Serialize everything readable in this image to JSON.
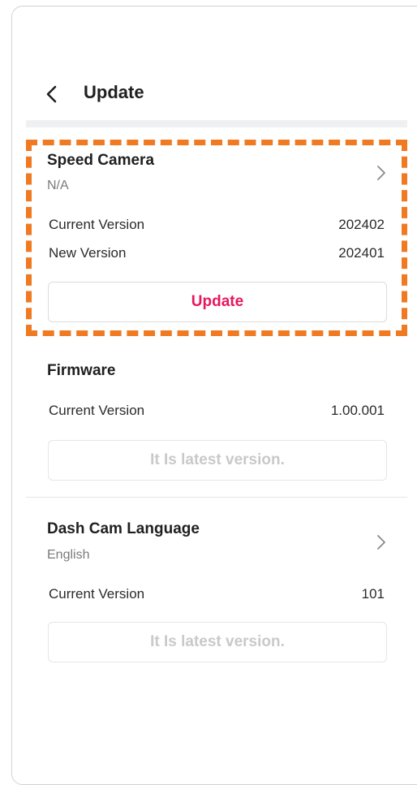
{
  "header": {
    "title": "Update",
    "back_icon": "chevron-left-icon"
  },
  "speed_camera": {
    "title": "Speed Camera",
    "subtitle": "N/A",
    "current_version_label": "Current Version",
    "current_version_value": "202402",
    "new_version_label": "New Version",
    "new_version_value": "202401",
    "button_label": "Update",
    "highlight_color": "#f07a22"
  },
  "firmware": {
    "title": "Firmware",
    "current_version_label": "Current Version",
    "current_version_value": "1.00.001",
    "button_label": "It Is latest version."
  },
  "language": {
    "title": "Dash Cam Language",
    "subtitle": "English",
    "current_version_label": "Current Version",
    "current_version_value": "101",
    "button_label": "It Is latest version."
  },
  "colors": {
    "accent": "#e8175d",
    "highlight": "#f07a22",
    "disabled_text": "#c9c9c9"
  }
}
